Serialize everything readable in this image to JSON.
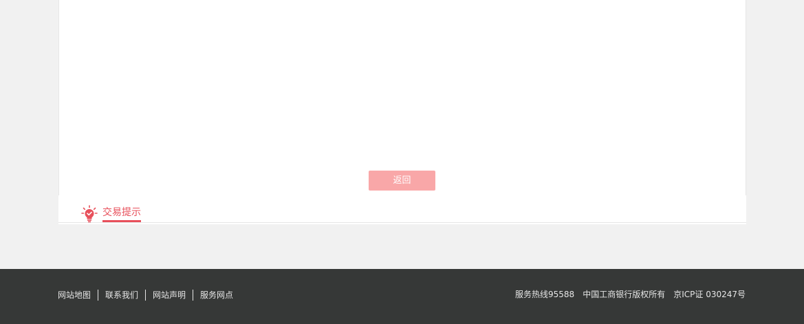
{
  "actions": {
    "return_label": "返回"
  },
  "tips": {
    "title": "交易提示",
    "icon": "lightbulb-icon"
  },
  "footer": {
    "links": [
      "网站地图",
      "联系我们",
      "网站声明",
      "服务网点"
    ],
    "hotline": "服务热线95588",
    "copyright": "中国工商银行版权所有",
    "icp": "京ICP证 030247号"
  },
  "colors": {
    "accent": "#e8505b",
    "button_bg": "#f9a7a8",
    "footer_bg": "#363837",
    "page_bg": "#f1f1f1"
  }
}
